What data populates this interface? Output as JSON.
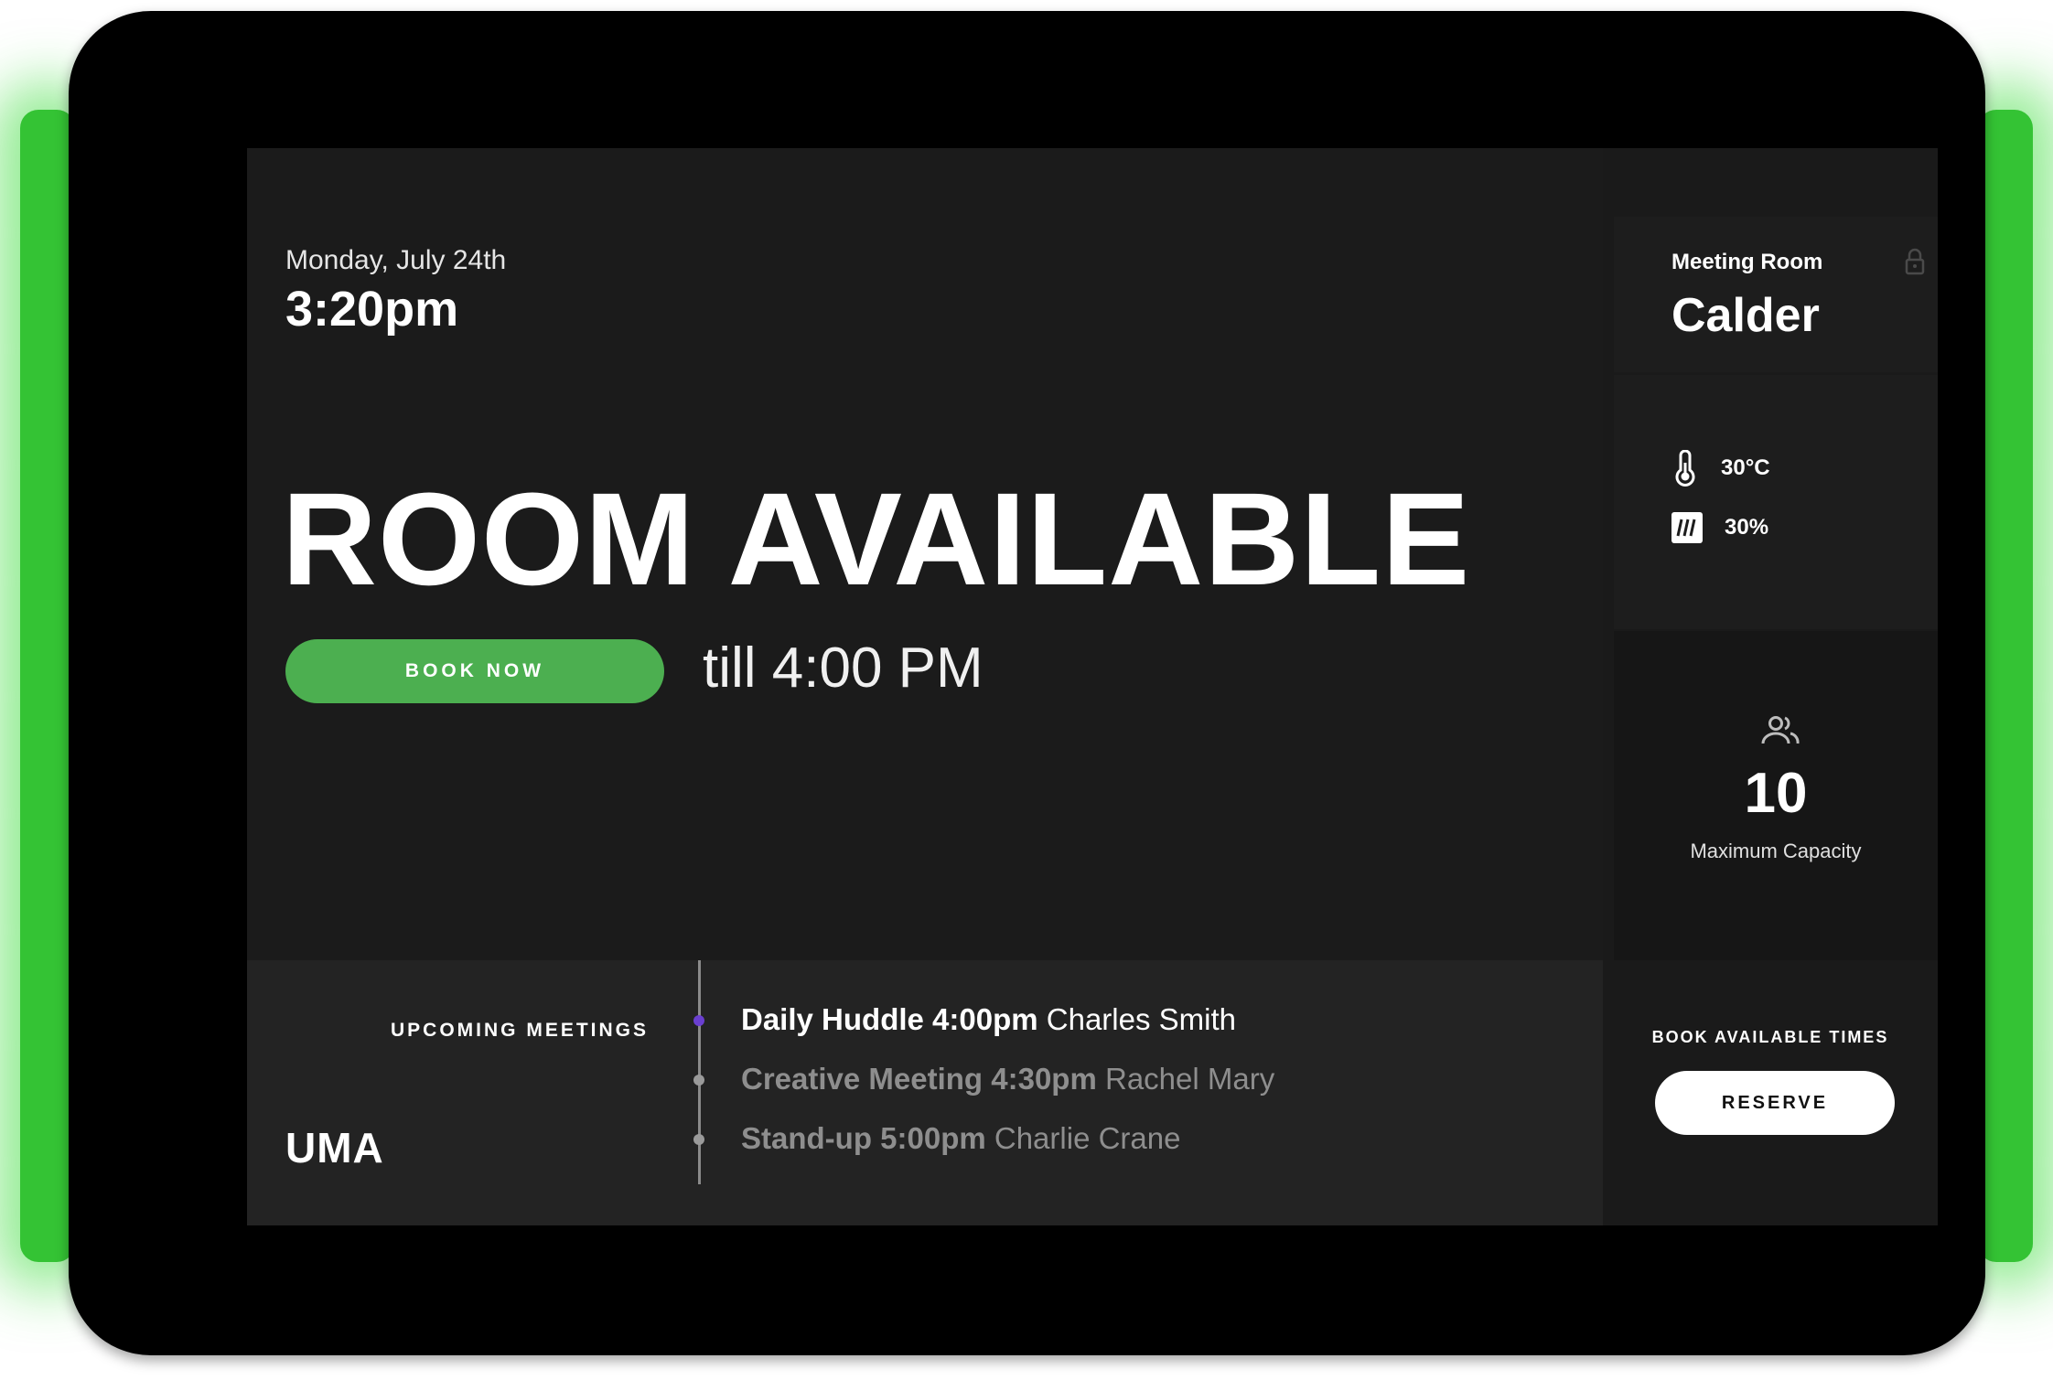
{
  "header": {
    "date": "Monday,  July 24th",
    "time": "3:20pm"
  },
  "status": {
    "headline": "ROOM AVAILABLE",
    "book_label": "BOOK NOW",
    "until": "till 4:00 PM"
  },
  "room": {
    "label": "Meeting Room",
    "name": "Calder",
    "lock_icon": "lock-icon"
  },
  "environment": {
    "temperature": "30°C",
    "humidity": "30%",
    "temperature_icon": "thermometer-icon",
    "humidity_icon": "humidity-icon"
  },
  "capacity": {
    "value": "10",
    "label": "Maximum Capacity",
    "icon": "people-icon"
  },
  "upcoming": {
    "label": "UPCOMING MEETINGS",
    "meetings": [
      {
        "title": "Daily Huddle 4:00pm",
        "host": "Charles Smith",
        "active": true
      },
      {
        "title": "Creative Meeting 4:30pm",
        "host": "Rachel Mary",
        "active": false
      },
      {
        "title": "Stand-up 5:00pm",
        "host": "Charlie Crane",
        "active": false
      }
    ]
  },
  "brand": {
    "logo": "UMA"
  },
  "reserve": {
    "label": "BOOK AVAILABLE TIMES",
    "button": "RESERVE"
  },
  "colors": {
    "accent": "#4caf50",
    "timeline_active": "#6a3fd0",
    "device_glow": "#34c334"
  }
}
